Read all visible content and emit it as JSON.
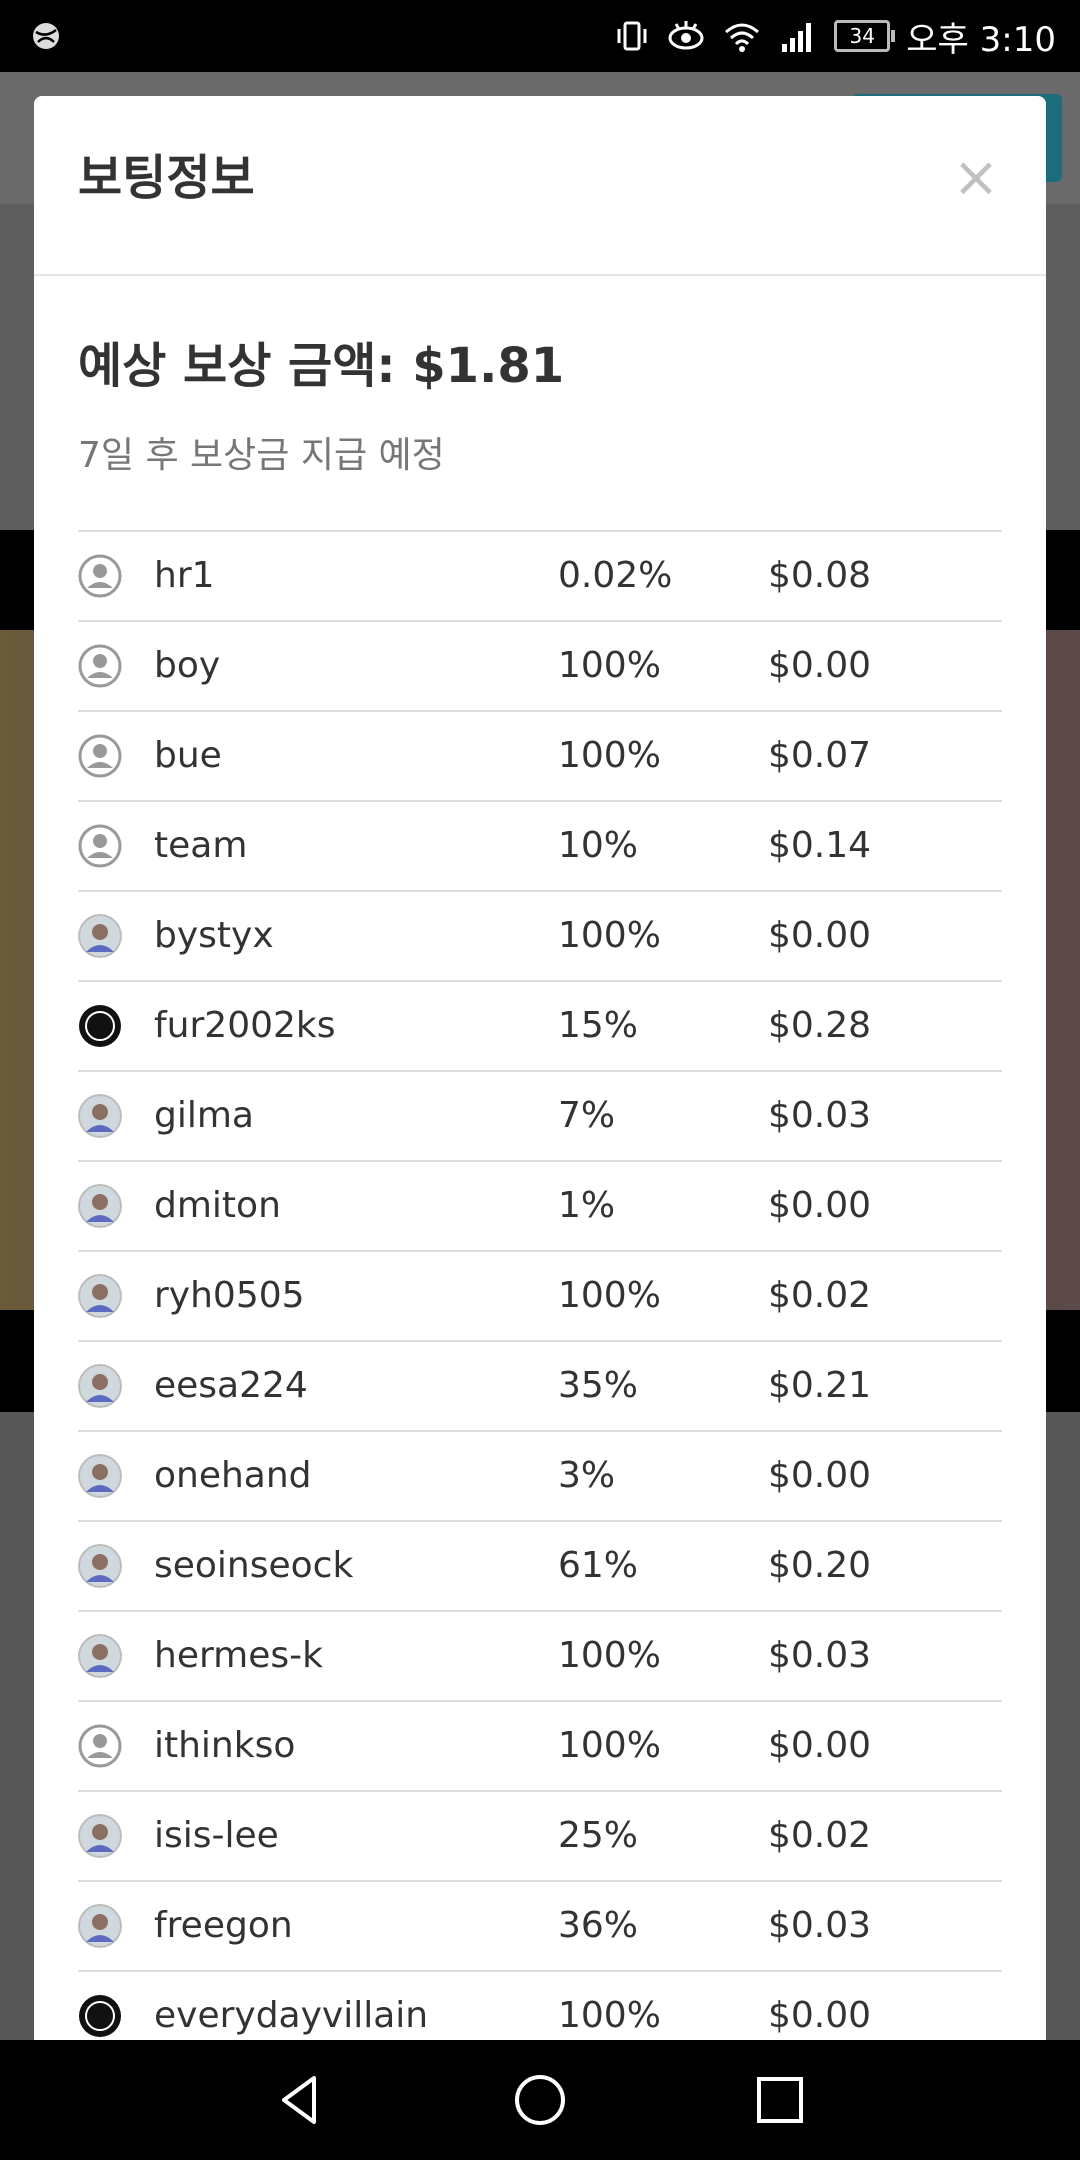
{
  "status_bar": {
    "time": "오후 3:10",
    "battery": "34"
  },
  "modal": {
    "title": "보팅정보",
    "close_label": "×",
    "reward_text": "예상 보상 금액: $1.81",
    "payout_text": "7일 후 보상금 지급 예정"
  },
  "votes": [
    {
      "name": "hr1",
      "percent": "0.02%",
      "amount": "$0.08",
      "avatar": "default-user-icon"
    },
    {
      "name": "boy",
      "percent": "100%",
      "amount": "$0.00",
      "avatar": "default-user-icon"
    },
    {
      "name": "bue",
      "percent": "100%",
      "amount": "$0.07",
      "avatar": "default-user-icon"
    },
    {
      "name": "team",
      "percent": "10%",
      "amount": "$0.14",
      "avatar": "default-user-icon"
    },
    {
      "name": "bystyx",
      "percent": "100%",
      "amount": "$0.00",
      "avatar": "photo-avatar"
    },
    {
      "name": "fur2002ks",
      "percent": "15%",
      "amount": "$0.28",
      "avatar": "logo-avatar"
    },
    {
      "name": "gilma",
      "percent": "7%",
      "amount": "$0.03",
      "avatar": "photo-avatar"
    },
    {
      "name": "dmiton",
      "percent": "1%",
      "amount": "$0.00",
      "avatar": "photo-avatar"
    },
    {
      "name": "ryh0505",
      "percent": "100%",
      "amount": "$0.02",
      "avatar": "photo-avatar"
    },
    {
      "name": "eesa224",
      "percent": "35%",
      "amount": "$0.21",
      "avatar": "photo-avatar"
    },
    {
      "name": "onehand",
      "percent": "3%",
      "amount": "$0.00",
      "avatar": "photo-avatar"
    },
    {
      "name": "seoinseock",
      "percent": "61%",
      "amount": "$0.20",
      "avatar": "photo-avatar"
    },
    {
      "name": "hermes-k",
      "percent": "100%",
      "amount": "$0.03",
      "avatar": "photo-avatar"
    },
    {
      "name": "ithinkso",
      "percent": "100%",
      "amount": "$0.00",
      "avatar": "default-user-icon"
    },
    {
      "name": "isis-lee",
      "percent": "25%",
      "amount": "$0.02",
      "avatar": "photo-avatar"
    },
    {
      "name": "freegon",
      "percent": "36%",
      "amount": "$0.03",
      "avatar": "photo-avatar"
    },
    {
      "name": "everydayvillain",
      "percent": "100%",
      "amount": "$0.00",
      "avatar": "logo-avatar"
    }
  ],
  "colors": {
    "text_primary": "#333333",
    "text_secondary": "#777777",
    "divider": "#dddddd",
    "overlay": "#5e5e5e"
  }
}
